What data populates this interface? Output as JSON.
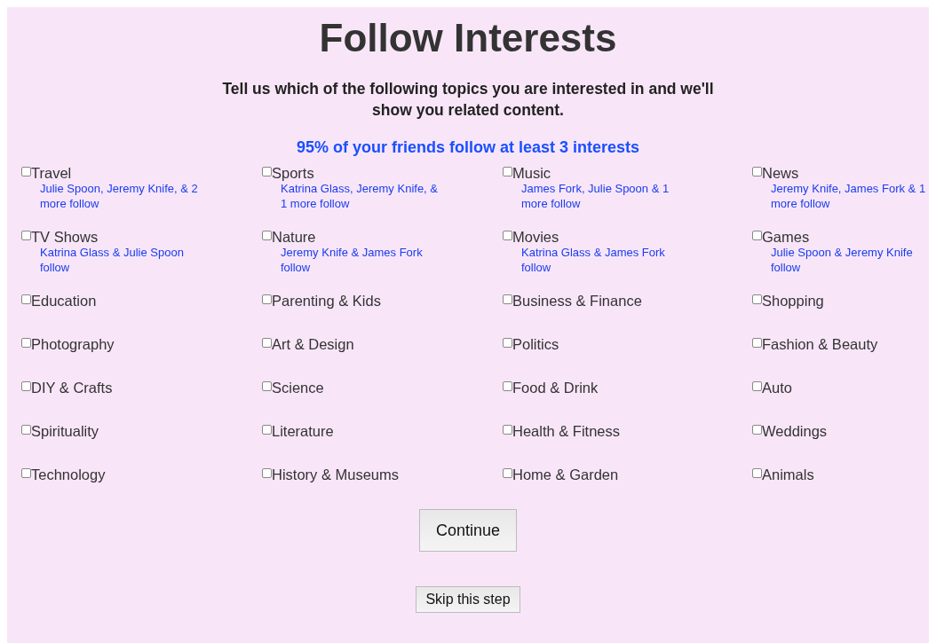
{
  "title": "Follow Interests",
  "subtitle": "Tell us which of the following topics you are interested in and we'll show you related content.",
  "friends_stat": "95% of your friends follow at least 3 interests",
  "interests": [
    {
      "label": "Travel",
      "checked": false,
      "friends": "Julie Spoon, Jeremy Knife, & 2 more follow"
    },
    {
      "label": "Sports",
      "checked": false,
      "friends": "Katrina Glass, Jeremy Knife, & 1 more follow"
    },
    {
      "label": "Music",
      "checked": false,
      "friends": "James Fork, Julie Spoon & 1 more follow"
    },
    {
      "label": "News",
      "checked": false,
      "friends": "Jeremy Knife, James Fork & 1 more follow"
    },
    {
      "label": "TV Shows",
      "checked": false,
      "friends": "Katrina Glass & Julie Spoon follow"
    },
    {
      "label": "Nature",
      "checked": false,
      "friends": "Jeremy Knife & James Fork follow"
    },
    {
      "label": "Movies",
      "checked": false,
      "friends": "Katrina Glass & James Fork follow"
    },
    {
      "label": "Games",
      "checked": false,
      "friends": "Julie Spoon & Jeremy Knife follow"
    },
    {
      "label": "Education",
      "checked": false
    },
    {
      "label": "Parenting & Kids",
      "checked": false
    },
    {
      "label": "Business & Finance",
      "checked": false
    },
    {
      "label": "Shopping",
      "checked": false
    },
    {
      "label": "Photography",
      "checked": false
    },
    {
      "label": "Art & Design",
      "checked": false
    },
    {
      "label": "Politics",
      "checked": false
    },
    {
      "label": "Fashion & Beauty",
      "checked": false
    },
    {
      "label": "DIY & Crafts",
      "checked": false
    },
    {
      "label": "Science",
      "checked": false
    },
    {
      "label": "Food & Drink",
      "checked": false
    },
    {
      "label": "Auto",
      "checked": false
    },
    {
      "label": "Spirituality",
      "checked": false
    },
    {
      "label": "Literature",
      "checked": false
    },
    {
      "label": "Health & Fitness",
      "checked": false
    },
    {
      "label": "Weddings",
      "checked": false
    },
    {
      "label": "Technology",
      "checked": false
    },
    {
      "label": "History & Museums",
      "checked": false
    },
    {
      "label": "Home & Garden",
      "checked": false
    },
    {
      "label": "Animals",
      "checked": false
    }
  ],
  "continue_button": "Continue",
  "skip_button": "Skip this step"
}
